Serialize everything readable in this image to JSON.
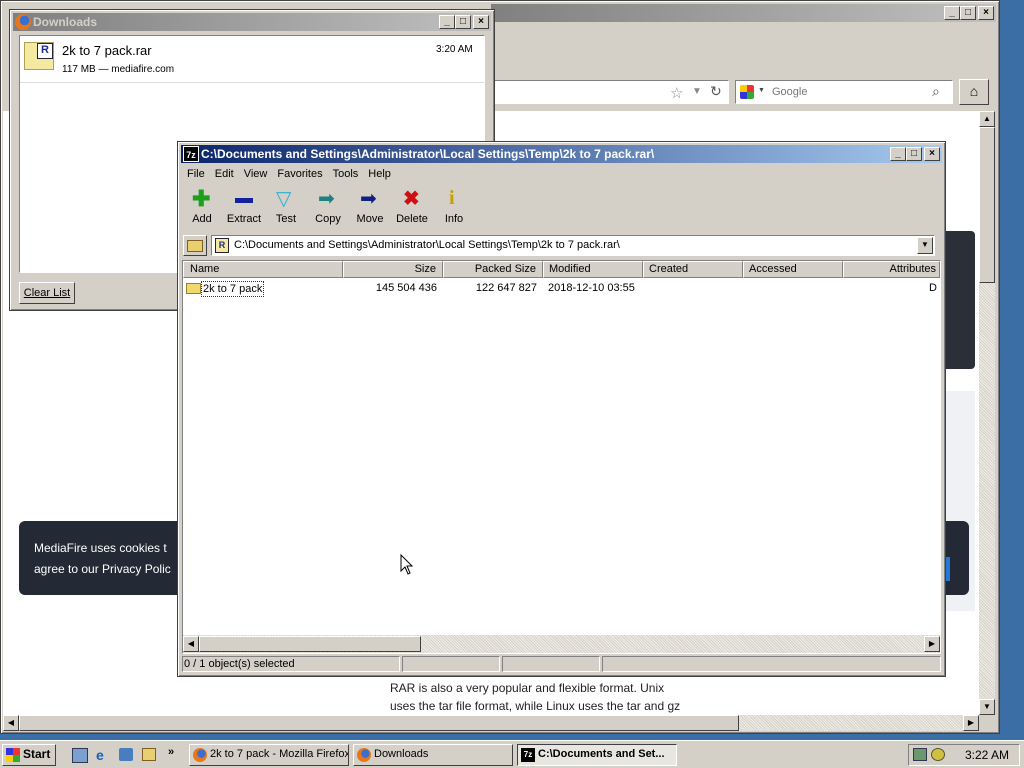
{
  "firefox": {
    "search_placeholder": "Google",
    "page_text_line1": "RAR is also a very popular and flexible format. Unix",
    "page_text_line2": "uses the tar file format, while Linux uses the tar and gz",
    "cookie_line1": "MediaFire uses cookies t",
    "cookie_line2": "agree to our Privacy Polic"
  },
  "downloads": {
    "title": "Downloads",
    "item": {
      "name": "2k to 7 pack.rar",
      "meta": "117 MB — mediafire.com",
      "time": "3:20 AM"
    },
    "clear_label": "Clear List"
  },
  "sevenzip": {
    "title": "C:\\Documents and Settings\\Administrator\\Local Settings\\Temp\\2k to 7 pack.rar\\",
    "menu": [
      "File",
      "Edit",
      "View",
      "Favorites",
      "Tools",
      "Help"
    ],
    "toolbar": [
      {
        "label": "Add",
        "icon": "add-icon",
        "color": "#1aa01a"
      },
      {
        "label": "Extract",
        "icon": "extract-icon",
        "color": "#1020a0"
      },
      {
        "label": "Test",
        "icon": "test-icon",
        "color": "#30b0d0"
      },
      {
        "label": "Copy",
        "icon": "copy-icon",
        "color": "#208080"
      },
      {
        "label": "Move",
        "icon": "move-icon",
        "color": "#102080"
      },
      {
        "label": "Delete",
        "icon": "delete-icon",
        "color": "#d01010"
      },
      {
        "label": "Info",
        "icon": "info-icon",
        "color": "#c8a000"
      }
    ],
    "address": "C:\\Documents and Settings\\Administrator\\Local Settings\\Temp\\2k to 7 pack.rar\\",
    "columns": [
      "Name",
      "Size",
      "Packed Size",
      "Modified",
      "Created",
      "Accessed",
      "Attributes"
    ],
    "rows": [
      {
        "name": "2k to 7 pack",
        "size": "145 504 436",
        "packed": "122 647 827",
        "modified": "2018-12-10 03:55",
        "created": "",
        "accessed": "",
        "attributes": "D"
      }
    ],
    "status": "0 / 1 object(s) selected"
  },
  "taskbar": {
    "start_label": "Start",
    "tasks": [
      {
        "label": "2k to 7 pack - Mozilla Firefox"
      },
      {
        "label": "Downloads"
      },
      {
        "label": "C:\\Documents and Set..."
      }
    ],
    "clock": "3:22 AM"
  }
}
